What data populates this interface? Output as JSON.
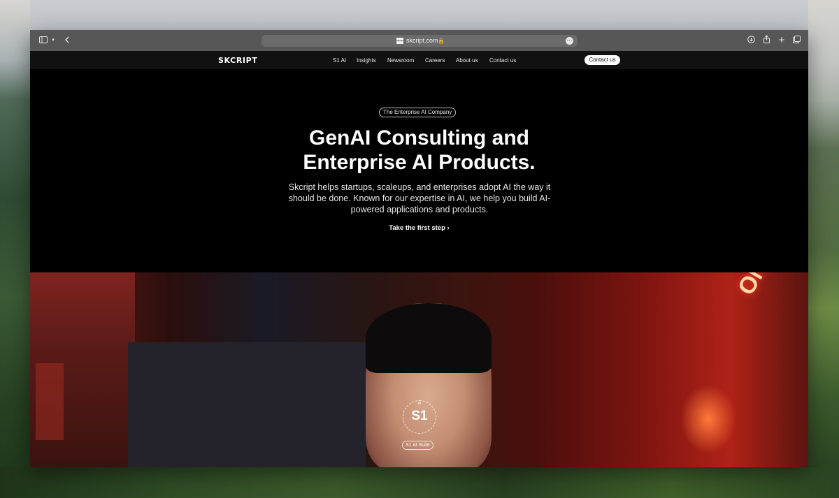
{
  "browser": {
    "url_host": "skcript.com",
    "icons": [
      "sidebar-icon",
      "chevron-down-icon",
      "back-icon",
      "lock-icon",
      "more-icon",
      "download-icon",
      "share-icon",
      "plus-icon",
      "tabs-icon"
    ]
  },
  "site": {
    "logo": "SKCRIPT",
    "nav": [
      "S1 AI",
      "Insights",
      "Newsroom",
      "Careers",
      "About us",
      "Contact us"
    ],
    "cta": "Contact us"
  },
  "hero": {
    "badge": "The Enterprise AI Company",
    "title_line1": "GenAI Consulting and",
    "title_line2": "Enterprise AI Products.",
    "subtitle": "Skcript helps startups, scaleups, and enterprises adopt AI the way it should be done. Known for our expertise in AI, we help you build AI-powered applications and products.",
    "link": "Take the first step"
  },
  "feature": {
    "s1_small": "AI",
    "s1_mark": "S1",
    "s1_badge": "S1 AI Suite",
    "neon_sign": "ON AIR"
  },
  "colors": {
    "chrome": "#575757",
    "nav_bg": "#111111",
    "hero_bg": "#000000",
    "accent_red": "#b02217"
  }
}
